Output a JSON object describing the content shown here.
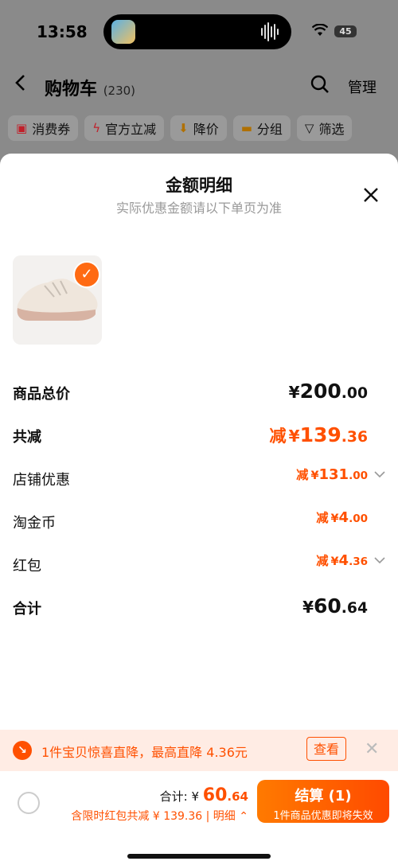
{
  "status_bar": {
    "time": "13:58",
    "battery": "45"
  },
  "nav": {
    "title": "购物车",
    "count": "(230)",
    "manage": "管理"
  },
  "chips": [
    {
      "label": "消费券",
      "icon": "coupon-icon"
    },
    {
      "label": "官方立减",
      "icon": "bolt-icon"
    },
    {
      "label": "降价",
      "icon": "price-drop-icon"
    },
    {
      "label": "分组",
      "icon": "folder-icon"
    },
    {
      "label": "筛选",
      "icon": "filter-icon"
    }
  ],
  "sheet": {
    "title": "金额明细",
    "subtitle": "实际优惠金额请以下单页为准",
    "rows": [
      {
        "label": "商品总价",
        "prefix": "",
        "currency": "¥",
        "integer": "200",
        "cents": ".00"
      },
      {
        "label": "共减",
        "prefix": "减",
        "currency": "¥",
        "integer": "139",
        "cents": ".36"
      },
      {
        "label": "店铺优惠",
        "prefix": "减",
        "currency": "¥",
        "integer": "131",
        "cents": ".00"
      },
      {
        "label": "淘金币",
        "prefix": "减",
        "currency": "¥",
        "integer": "4",
        "cents": ".00"
      },
      {
        "label": "红包",
        "prefix": "减",
        "currency": "¥",
        "integer": "4",
        "cents": ".36"
      },
      {
        "label": "合计",
        "prefix": "",
        "currency": "¥",
        "integer": "60",
        "cents": ".64"
      }
    ]
  },
  "promo": {
    "text": "1件宝贝惊喜直降，最高直降 4.36元",
    "button": "查看"
  },
  "bottom": {
    "total_label": "合计: ¥",
    "total_integer": "60",
    "total_cents": ".64",
    "discount_text": "含限时红包共减 ¥ 139.36 | 明细",
    "checkout_label": "结算 (1)",
    "checkout_sub": "1件商品优惠即将失效"
  },
  "colors": {
    "accent": "#ff5000",
    "background_overlay": "#8a8a8a"
  }
}
